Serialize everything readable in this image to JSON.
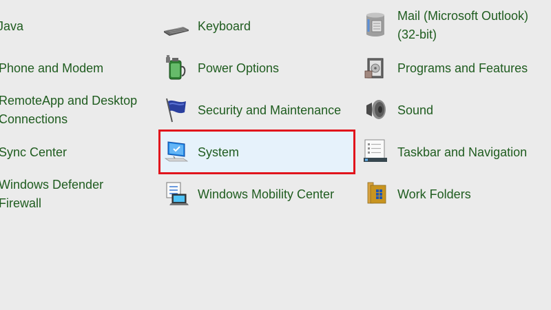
{
  "column1": {
    "java": "Java",
    "phone_modem": "Phone and Modem",
    "remoteapp_line1": "RemoteApp and Desktop",
    "remoteapp_line2": "Connections",
    "sync_center": "Sync Center",
    "defender_line1": "Windows Defender",
    "defender_line2": "Firewall"
  },
  "column2": {
    "keyboard": "Keyboard",
    "power_options": "Power Options",
    "security_maintenance": "Security and Maintenance",
    "system": "System",
    "mobility_center": "Windows Mobility Center"
  },
  "column3": {
    "mail_line1": "Mail (Microsoft Outlook)",
    "mail_line2": "(32-bit)",
    "programs_features": "Programs and Features",
    "sound": "Sound",
    "taskbar_navigation": "Taskbar and Navigation",
    "work_folders": "Work Folders"
  },
  "colors": {
    "label_green": "#1f5c1f",
    "highlight_border": "#e1141c",
    "highlight_fill": "#e6f2fb",
    "background": "#ebebeb"
  },
  "highlighted_item": "System",
  "icons": [
    "keyboard-icon",
    "power-options-icon",
    "security-maintenance-icon",
    "system-icon",
    "mobility-center-icon",
    "mail-icon",
    "programs-features-icon",
    "sound-icon",
    "taskbar-icon",
    "work-folders-icon"
  ]
}
